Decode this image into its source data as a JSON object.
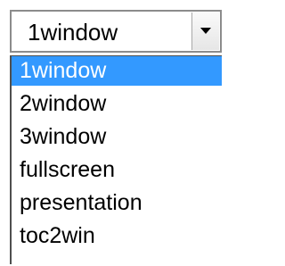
{
  "select": {
    "current_value": "1window",
    "dropdown_icon": "chevron-down-icon"
  },
  "options": [
    {
      "label": "1window",
      "selected": true
    },
    {
      "label": "2window",
      "selected": false
    },
    {
      "label": "3window",
      "selected": false
    },
    {
      "label": "fullscreen",
      "selected": false
    },
    {
      "label": "presentation",
      "selected": false
    },
    {
      "label": "toc2win",
      "selected": false
    }
  ],
  "colors": {
    "highlight": "#3399ff",
    "highlight_text": "#ffffff",
    "text": "#000000"
  }
}
